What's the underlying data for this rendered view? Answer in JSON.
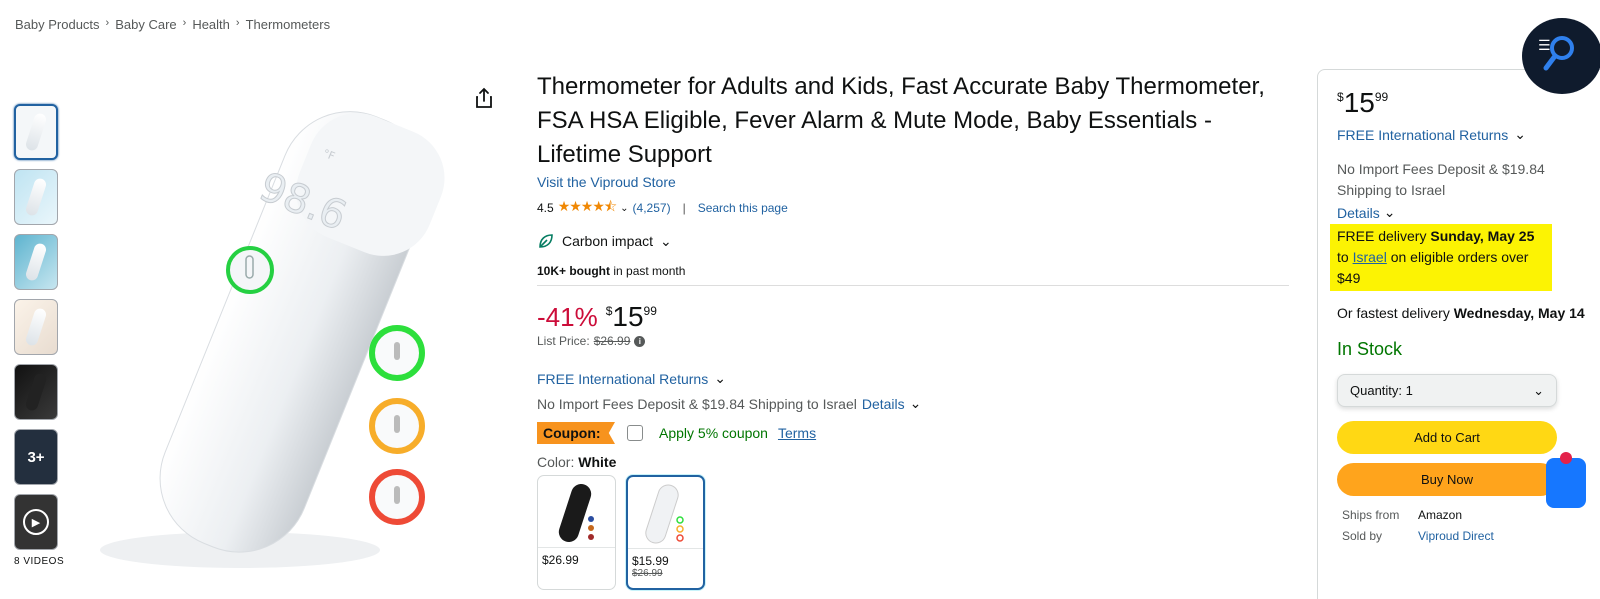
{
  "breadcrumb": [
    "Baby Products",
    "Baby Care",
    "Health",
    "Thermometers"
  ],
  "thumbnails": {
    "more_label": "3+",
    "videos_label": "8 VIDEOS"
  },
  "product": {
    "title": "Thermometer for Adults and Kids, Fast Accurate Baby Thermometer, FSA HSA Eligible, Fever Alarm & Mute Mode, Baby Essentials - Lifetime Support",
    "store_link": "Visit the Viproud Store",
    "rating": "4.5",
    "rating_count": "(4,257)",
    "search_page": "Search this page",
    "carbon_label": "Carbon impact",
    "bought_bold": "10K+ bought",
    "bought_rest": " in past month",
    "display_temp": "98.6",
    "temp_unit": "°F"
  },
  "pricing": {
    "discount": "-41%",
    "currency": "$",
    "whole": "15",
    "fraction": "99",
    "list_label": "List Price:",
    "list_value": "$26.99",
    "info_icon": "i",
    "returns": "FREE International Returns",
    "import": "No Import Fees Deposit & $19.84 Shipping to Israel",
    "details": "Details"
  },
  "coupon": {
    "badge": "Coupon:",
    "text": "Apply 5% coupon",
    "terms": "Terms"
  },
  "color": {
    "label": "Color:",
    "value": "White",
    "options": [
      {
        "price": "$26.99",
        "old": ""
      },
      {
        "price": "$15.99",
        "old": "$26.99"
      }
    ]
  },
  "buybox": {
    "currency": "$",
    "whole": "15",
    "fraction": "99",
    "returns": "FREE International Returns",
    "import": "No Import Fees Deposit & $19.84 Shipping to Israel",
    "details": "Details",
    "delivery_a": "FREE delivery ",
    "delivery_date": "Sunday, May 25",
    "delivery_b": " to ",
    "delivery_link": "Israel",
    "delivery_c": " on eligible orders over $49",
    "fast_a": "Or fastest delivery ",
    "fast_date": "Wednesday, May 14",
    "stock": "In Stock",
    "qty_label": "Quantity:",
    "qty_value": "1",
    "add_to_cart": "Add to Cart",
    "buy_now": "Buy Now",
    "ships_from_label": "Ships from",
    "ships_from_value": "Amazon",
    "sold_by_label": "Sold by",
    "sold_by_value": "Viproud Direct"
  },
  "colors": {
    "link": "#2162a1",
    "discount": "#cc0c39",
    "stock": "#007600",
    "cart": "#ffd814",
    "buy": "#ffa41c",
    "highlight": "#fcf303",
    "coupon": "#f7931e"
  }
}
